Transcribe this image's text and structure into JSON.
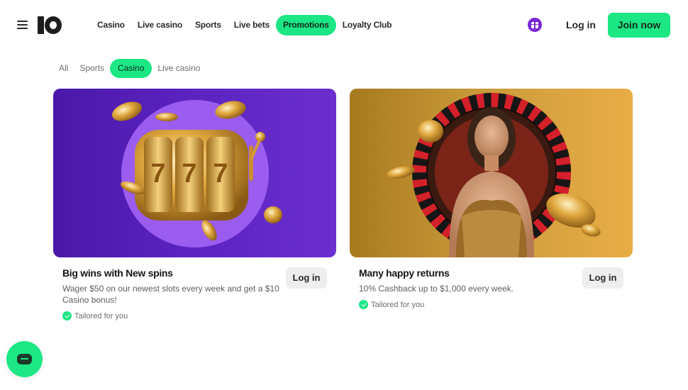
{
  "header": {
    "menu_icon": "hamburger-menu-icon",
    "logo_icon": "10bet-logo",
    "nav": [
      {
        "label": "Casino",
        "active": false
      },
      {
        "label": "Live casino",
        "active": false
      },
      {
        "label": "Sports",
        "active": false
      },
      {
        "label": "Live bets",
        "active": false
      },
      {
        "label": "Promotions",
        "active": true
      },
      {
        "label": "Loyalty Club",
        "active": false
      }
    ],
    "gift_icon": "gift-icon",
    "login_label": "Log in",
    "join_label": "Join now"
  },
  "filters": [
    {
      "label": "All",
      "active": false
    },
    {
      "label": "Sports",
      "active": false
    },
    {
      "label": "Casino",
      "active": true
    },
    {
      "label": "Live casino",
      "active": false
    }
  ],
  "cards": [
    {
      "image": "slot-machine-777-illustration",
      "title": "Big wins with New spins",
      "description": "Wager $50 on our newest slots every week and get a $10 Casino bonus!",
      "tag": "Tailored for you",
      "button_label": "Log in"
    },
    {
      "image": "roulette-woman-illustration",
      "title": "Many happy returns",
      "description": "10% Cashback up to $1,000 every week.",
      "tag": "Tailored for you",
      "button_label": "Log in"
    }
  ],
  "chat_icon": "chat-bubble-icon",
  "colors": {
    "accent": "#1ce784",
    "purple": "#5a22c0",
    "gold": "#e9ad46"
  }
}
